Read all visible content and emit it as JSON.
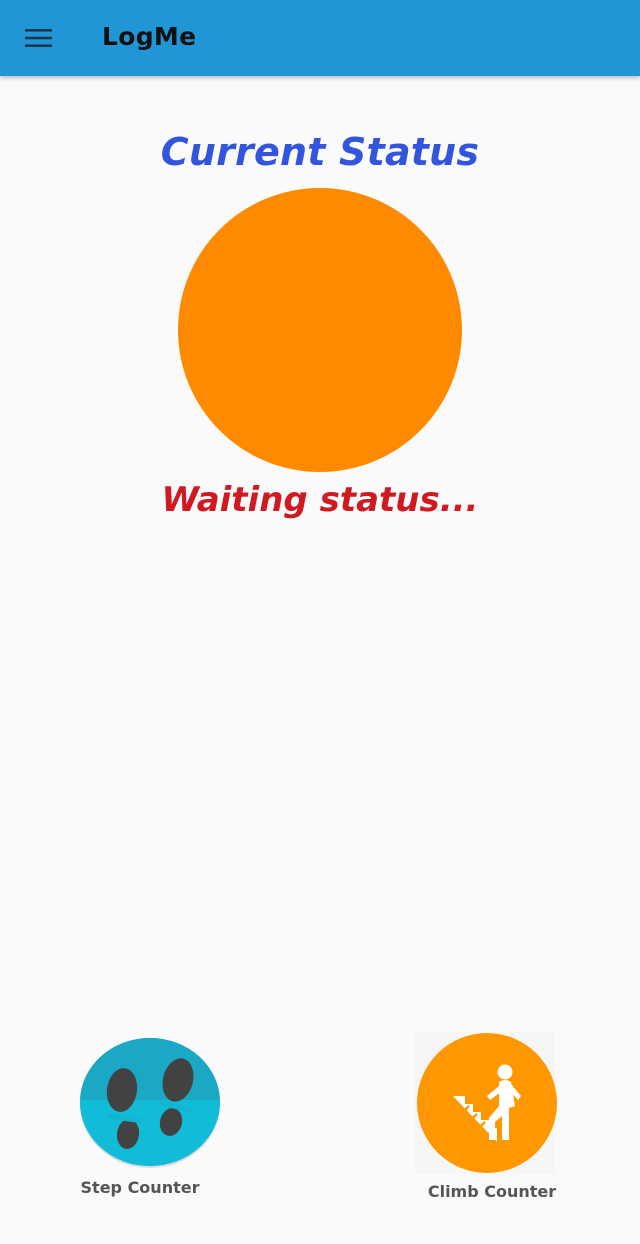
{
  "app": {
    "title": "LogMe"
  },
  "status": {
    "heading": "Current Status",
    "message": "Waiting status...",
    "indicator_color": "#ff8a00"
  },
  "actions": [
    {
      "label": "Step Counter",
      "icon": "footprints-icon",
      "color": "#14b4cf"
    },
    {
      "label": "Climb Counter",
      "icon": "stairs-climber-icon",
      "color": "#ff9800"
    }
  ],
  "colors": {
    "app_bar": "#2196d6",
    "heading": "#3355dd",
    "message": "#d01a22",
    "background": "#fafafa"
  }
}
